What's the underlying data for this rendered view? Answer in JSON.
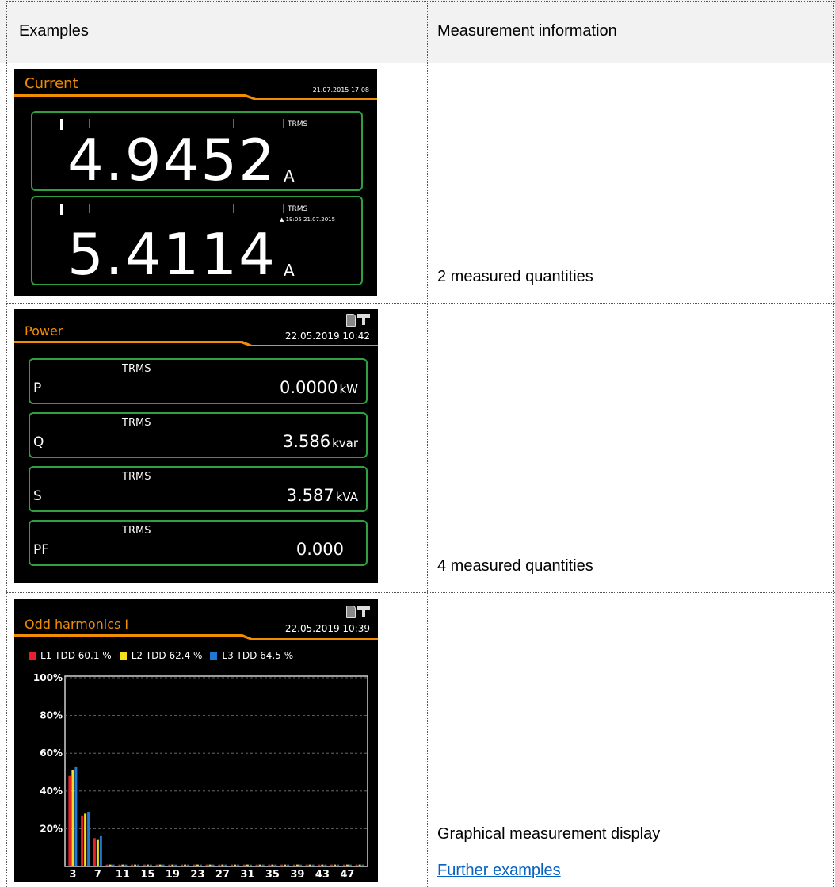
{
  "table": {
    "headers": [
      "Examples",
      "Measurement information"
    ],
    "rows": [
      {
        "info": "2 measured quantities"
      },
      {
        "info": "4 measured quantities"
      },
      {
        "info": "Graphical measurement display",
        "link": "Further examples"
      }
    ]
  },
  "current_screen": {
    "title": "Current",
    "datetime": "21.07.2015 17:08",
    "accent_color": "#f28c00",
    "box_color": "#2ea043",
    "quantities": [
      {
        "label": "I",
        "mode": "TRMS",
        "value": "4.9452",
        "unit": "A",
        "extra": ""
      },
      {
        "label": "I",
        "mode": "TRMS",
        "value": "5.4114",
        "unit": "A",
        "extra": "▲ 19:05 21.07.2015"
      }
    ]
  },
  "power_screen": {
    "title": "Power",
    "datetime": "22.05.2019   10:42",
    "icons": [
      "sd-card-icon",
      "network-icon"
    ],
    "quantities": [
      {
        "label": "P",
        "mode": "TRMS",
        "value": "0.0000",
        "unit": "kW"
      },
      {
        "label": "Q",
        "mode": "TRMS",
        "value": "3.586",
        "unit": "kvar"
      },
      {
        "label": "S",
        "mode": "TRMS",
        "value": "3.587",
        "unit": "kVA"
      },
      {
        "label": "PF",
        "mode": "TRMS",
        "value": "0.000",
        "unit": ""
      }
    ]
  },
  "harmonics_screen": {
    "title": "Odd harmonics I",
    "datetime": "22.05.2019   10:39",
    "icons": [
      "sd-card-icon",
      "network-icon"
    ],
    "legend": [
      {
        "text": "L1  TDD  60.1 %",
        "color": "#e8202a"
      },
      {
        "text": "L2  TDD  62.4 %",
        "color": "#f5e11b"
      },
      {
        "text": "L3  TDD  64.5 %",
        "color": "#1e78d4"
      }
    ]
  },
  "chart_data": {
    "type": "bar",
    "title": "Odd harmonics I",
    "xlabel": "",
    "ylabel": "",
    "ylim": [
      0,
      100
    ],
    "grid": true,
    "legend_position": "top",
    "y_tick_labels": [
      "100%",
      "80%",
      "60%",
      "40%",
      "20%"
    ],
    "y_tick_values": [
      100,
      80,
      60,
      40,
      20
    ],
    "categories": [
      3,
      5,
      7,
      9,
      11,
      13,
      15,
      17,
      19,
      21,
      23,
      25,
      27,
      29,
      31,
      33,
      35,
      37,
      39,
      41,
      43,
      45,
      47,
      49
    ],
    "x_tick_labels": [
      "3",
      "7",
      "11",
      "15",
      "19",
      "23",
      "27",
      "31",
      "35",
      "39",
      "43",
      "47"
    ],
    "series": [
      {
        "name": "L1",
        "color": "#e8202a",
        "values": [
          48,
          27,
          15,
          1,
          1,
          1,
          1,
          1,
          1,
          1,
          1,
          1,
          1,
          1,
          1,
          1,
          1,
          1,
          1,
          1,
          1,
          1,
          1,
          1
        ]
      },
      {
        "name": "L2",
        "color": "#f5e11b",
        "values": [
          51,
          28,
          14,
          1,
          1,
          1,
          1,
          1,
          1,
          1,
          1,
          1,
          1,
          1,
          1,
          1,
          1,
          1,
          1,
          1,
          1,
          1,
          1,
          1
        ]
      },
      {
        "name": "L3",
        "color": "#1e78d4",
        "values": [
          53,
          29,
          16,
          1,
          1,
          1,
          1,
          1,
          1,
          1,
          1,
          1,
          1,
          1,
          1,
          1,
          1,
          1,
          1,
          1,
          1,
          1,
          1,
          1
        ]
      }
    ]
  }
}
